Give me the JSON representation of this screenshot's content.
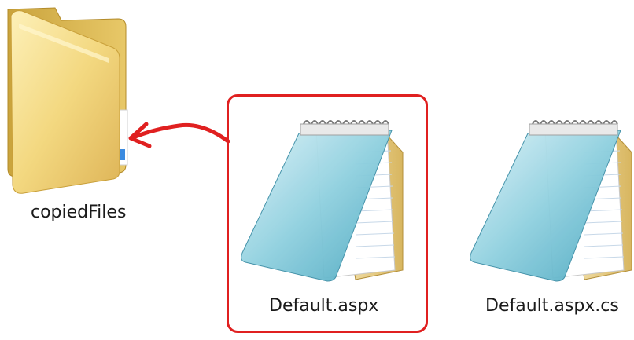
{
  "window": {
    "background": "#ffffff"
  },
  "items": [
    {
      "label": "copiedFiles",
      "icon": "folder-icon"
    },
    {
      "label": "Default.aspx",
      "icon": "notepad-file-icon",
      "selected": true
    },
    {
      "label": "Default.aspx.cs",
      "icon": "notepad-file-icon"
    }
  ],
  "annotation": {
    "color": "#e02020",
    "icon": "arrow-icon"
  }
}
